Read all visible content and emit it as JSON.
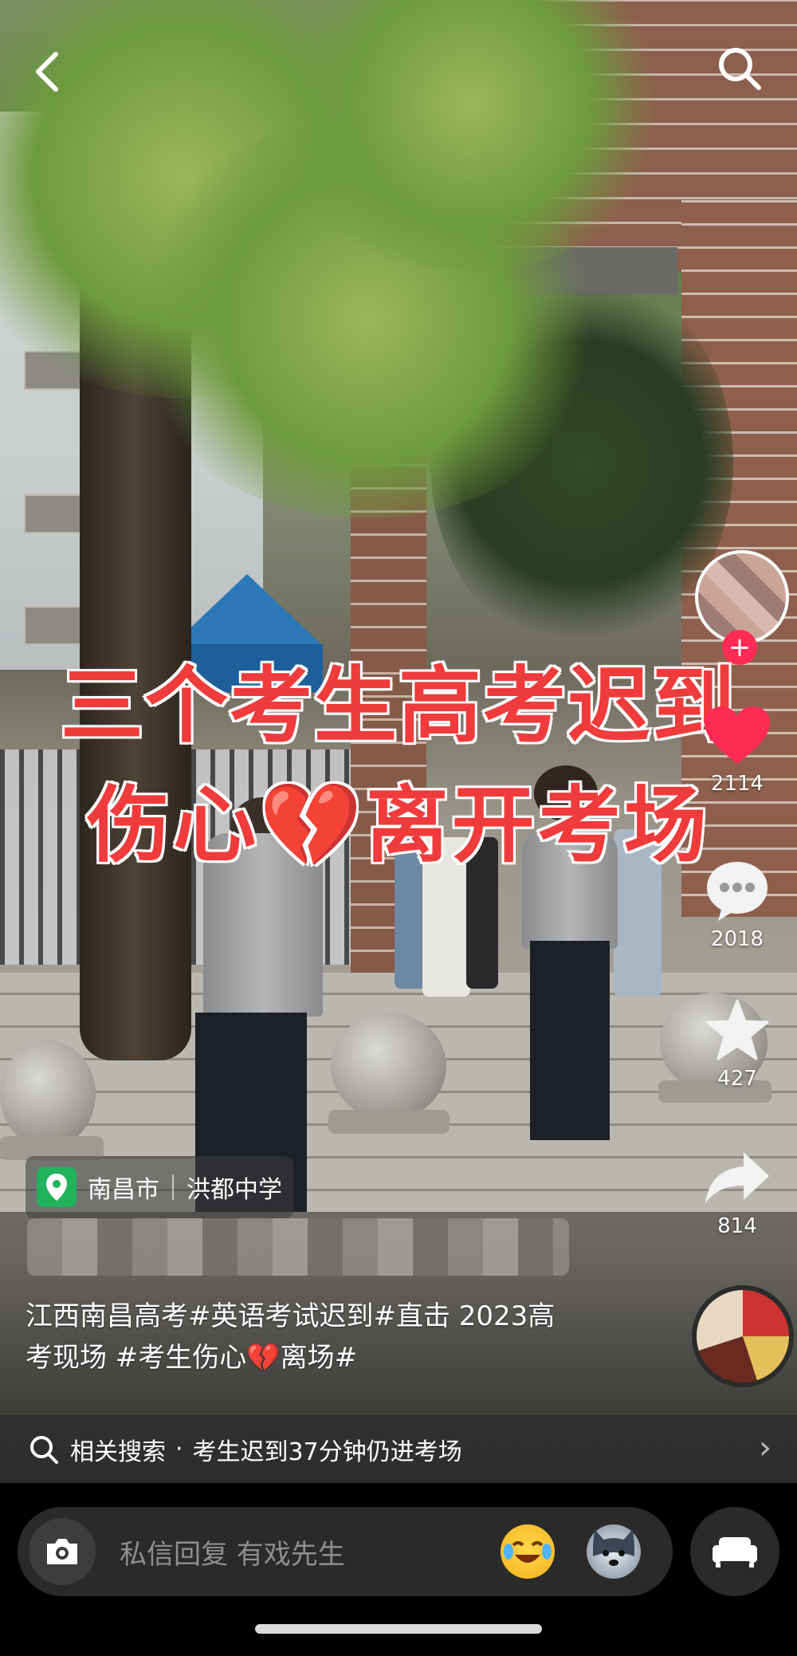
{
  "video": {
    "overlay_title_line1": "三个考生高考迟到",
    "overlay_title_line2_a": "伤心",
    "overlay_title_line2_emoji": "💔",
    "overlay_title_line2_b": "离开考场",
    "title_color": "#ef3b3b"
  },
  "topbar": {
    "back_icon": "chevron-left-icon",
    "search_icon": "search-icon"
  },
  "sidebar": {
    "like_count": "2114",
    "comment_count": "2018",
    "favorite_count": "427",
    "share_count": "814"
  },
  "location": {
    "city": "南昌市",
    "place": "洪都中学"
  },
  "caption": {
    "line1": "江西南昌高考#英语考试迟到#直击 2023高",
    "line2_a": "考现场 #考生伤心",
    "line2_emoji": "💔",
    "line2_b": "离场#"
  },
  "related": {
    "label": "相关搜索",
    "separator": "·",
    "query": "考生迟到37分钟仍进考场"
  },
  "bottom": {
    "message_placeholder": "私信回复 有戏先生"
  },
  "colors": {
    "accent": "#fe2c55",
    "location_pin": "#21b35b"
  }
}
